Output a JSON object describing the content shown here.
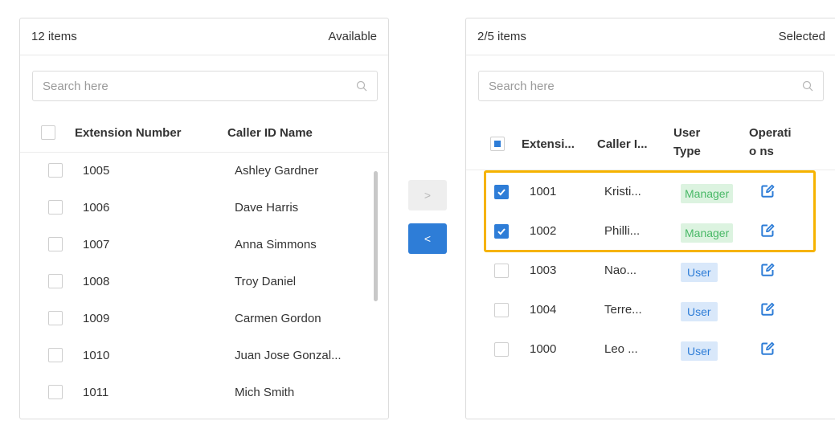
{
  "left": {
    "count": "12 items",
    "title": "Available",
    "search_placeholder": "Search here",
    "columns": [
      "Extension Number",
      "Caller ID Name"
    ],
    "rows": [
      {
        "ext": "1005",
        "name": "Ashley Gardner"
      },
      {
        "ext": "1006",
        "name": "Dave Harris"
      },
      {
        "ext": "1007",
        "name": "Anna Simmons"
      },
      {
        "ext": "1008",
        "name": "Troy Daniel"
      },
      {
        "ext": "1009",
        "name": "Carmen Gordon"
      },
      {
        "ext": "1010",
        "name": "Juan Jose Gonzal..."
      },
      {
        "ext": "1011",
        "name": "Mich Smith"
      }
    ]
  },
  "transfer": {
    "right_arrow": ">",
    "left_arrow": "<"
  },
  "right": {
    "count": "2/5 items",
    "title": "Selected",
    "search_placeholder": "Search here",
    "columns": [
      "Extensi...",
      "Caller I...",
      "User Type",
      "Operatio ns"
    ],
    "rows": [
      {
        "ext": "1001",
        "name": "Kristi...",
        "type": "Manager",
        "checked": true
      },
      {
        "ext": "1002",
        "name": "Philli...",
        "type": "Manager",
        "checked": true
      },
      {
        "ext": "1003",
        "name": "Nao...",
        "type": "User",
        "checked": false
      },
      {
        "ext": "1004",
        "name": "Terre...",
        "type": "User",
        "checked": false
      },
      {
        "ext": "1000",
        "name": "Leo ...",
        "type": "User",
        "checked": false
      }
    ]
  },
  "colors": {
    "accent": "#2e7dd7",
    "manager_bg": "#dcf3e0",
    "manager_text": "#48b866",
    "user_bg": "#d9e8fa",
    "highlight": "#f6b300"
  }
}
